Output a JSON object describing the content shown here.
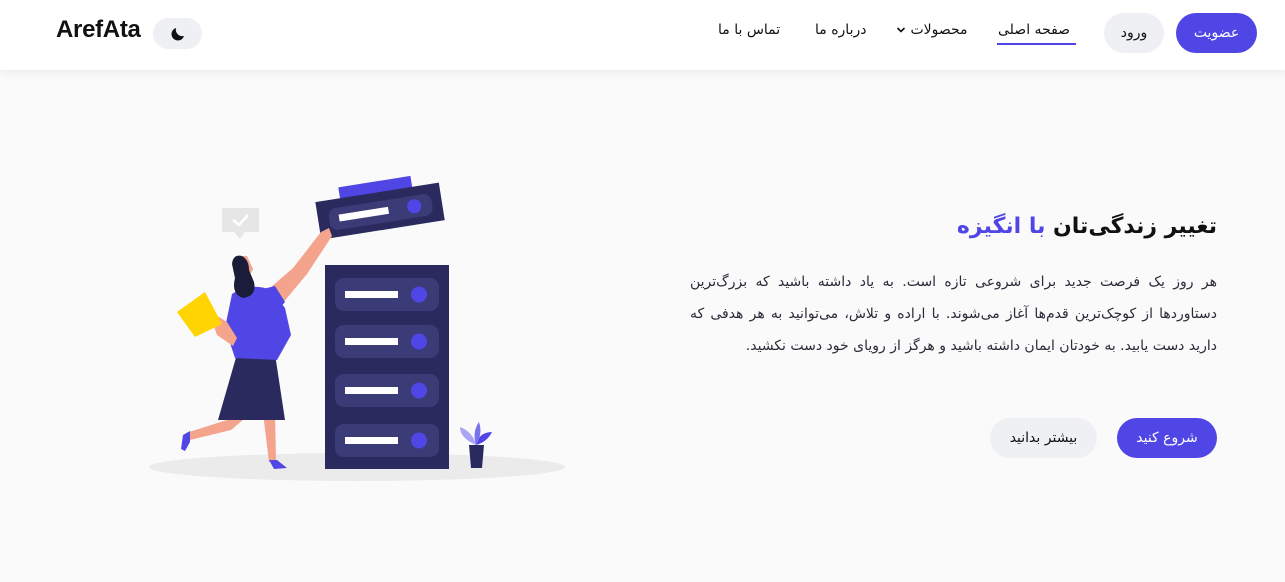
{
  "header": {
    "logo": "ArefAta",
    "theme_icon": "moon-icon",
    "nav": {
      "home": "صفحه اصلی",
      "products": "محصولات",
      "about": "درباره ما",
      "contact": "تماس با ما"
    },
    "login_label": "ورود",
    "signup_label": "عضویت"
  },
  "hero": {
    "title_main": "تغییر زندگی‌تان ",
    "title_accent": "با انگیزه",
    "description": "هر روز یک فرصت جدید برای شروعی تازه است. به یاد داشته باشید که بزرگ‌ترین دستاوردها از کوچک‌ترین قدم‌ها آغاز می‌شوند. با اراده و تلاش، می‌توانید به هر هدفی که دارید دست یابید. به خودتان ایمان داشته باشید و هرگز از رویای خود دست نکشید.",
    "start_label": "شروع کنید",
    "more_label": "بیشتر بدانید"
  },
  "colors": {
    "accent": "#5046e5",
    "dark_navy": "#2a2a5e",
    "skin": "#f4a38c",
    "yellow": "#ffd400"
  }
}
